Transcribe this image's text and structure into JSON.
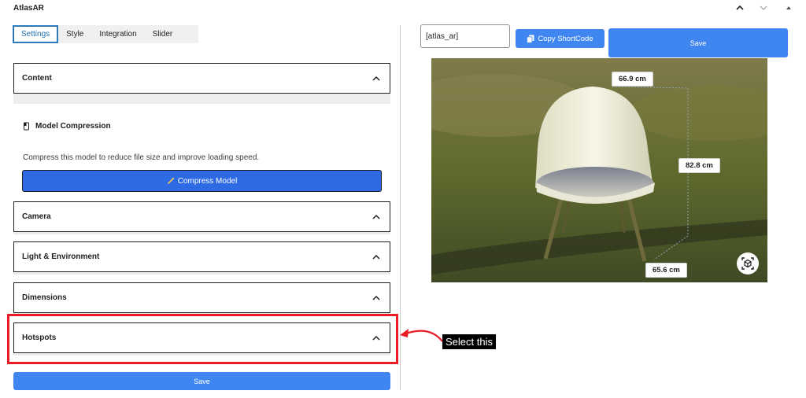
{
  "app": {
    "title": "AtlasAR"
  },
  "tabs": [
    {
      "label": "Settings",
      "active": true
    },
    {
      "label": "Style",
      "active": false
    },
    {
      "label": "Integration",
      "active": false
    },
    {
      "label": "Slider",
      "active": false
    }
  ],
  "panels": {
    "content": "Content",
    "camera": "Camera",
    "light": "Light & Environment",
    "dimensions": "Dimensions",
    "hotspots": "Hotspots"
  },
  "compression": {
    "title": "Model Compression",
    "description": "Compress this model to reduce file size and improve loading speed.",
    "button_label": "Compress Model"
  },
  "left_save_label": "Save",
  "shortcode": {
    "value": "[atlas_ar]",
    "copy_label": "Copy ShortCode"
  },
  "right_save_label": "Save",
  "viewer": {
    "dimensions": {
      "width": "66.9 cm",
      "height": "82.8 cm",
      "depth": "65.6 cm"
    }
  },
  "annotation": {
    "callout": "Select this"
  },
  "colors": {
    "primary": "#3f86f1",
    "compress": "#2d6ae3",
    "highlight": "#ea1c24",
    "tab_active": "#2271b1"
  }
}
